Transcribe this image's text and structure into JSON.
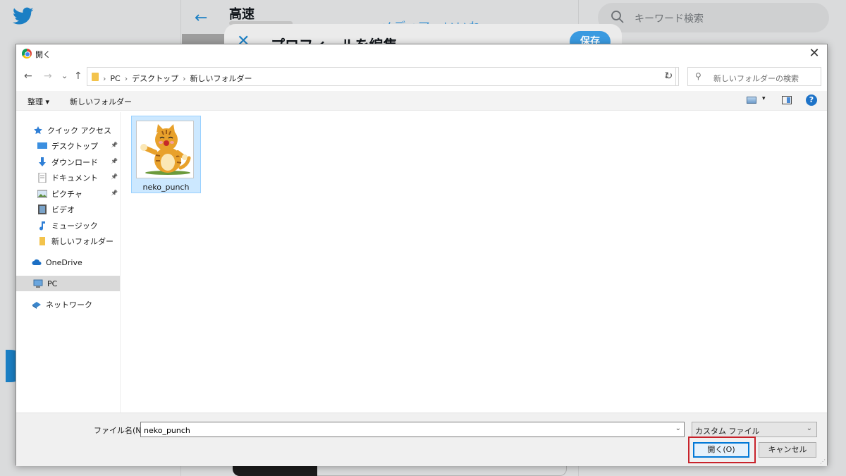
{
  "background": {
    "page_title": "高速",
    "tabs_text": "メディア　いいね",
    "search_placeholder": "キーワード検索",
    "modal_title": "プロフィールを編集",
    "modal_save": "保存",
    "modal_close": "✕",
    "back_arrow": "←"
  },
  "dialog": {
    "title": "開く",
    "close": "✕",
    "nav": {
      "back": "←",
      "forward": "→",
      "recent": "⌄",
      "up": "↑"
    },
    "breadcrumbs": [
      "PC",
      "デスクトップ",
      "新しいフォルダー"
    ],
    "breadcrumb_sep": "›",
    "address_dropdown": "⌄",
    "refresh": "↻",
    "search_placeholder": "新しいフォルダーの検索",
    "search_icon": "⚲",
    "toolbar": {
      "organize": "整理 ▾",
      "new_folder": "新しいフォルダー",
      "view_dropdown": "▾",
      "help": "?"
    },
    "sidebar": {
      "quick_access": "クイック アクセス",
      "items": [
        {
          "label": "デスクトップ",
          "icon": "desktop-icon"
        },
        {
          "label": "ダウンロード",
          "icon": "download-icon"
        },
        {
          "label": "ドキュメント",
          "icon": "document-icon"
        },
        {
          "label": "ピクチャ",
          "icon": "pictures-icon"
        },
        {
          "label": "ビデオ",
          "icon": "video-icon"
        },
        {
          "label": "ミュージック",
          "icon": "music-icon"
        },
        {
          "label": "新しいフォルダー",
          "icon": "folder-icon"
        }
      ],
      "onedrive": "OneDrive",
      "pc": "PC",
      "network": "ネットワーク",
      "pin": "📌"
    },
    "files": [
      {
        "name": "neko_punch"
      }
    ],
    "footer": {
      "filename_label": "ファイル名(N):",
      "filename_value": "neko_punch",
      "filename_dropdown": "⌄",
      "filetype": "カスタム ファイル",
      "filetype_dropdown": "⌄",
      "open_button": "開く(O)",
      "cancel_button": "キャンセル"
    },
    "colors": {
      "selection_bg": "#cce8ff",
      "accent": "#0078d7",
      "highlight_box": "#c8222a",
      "folder": "#f3c34c"
    }
  }
}
